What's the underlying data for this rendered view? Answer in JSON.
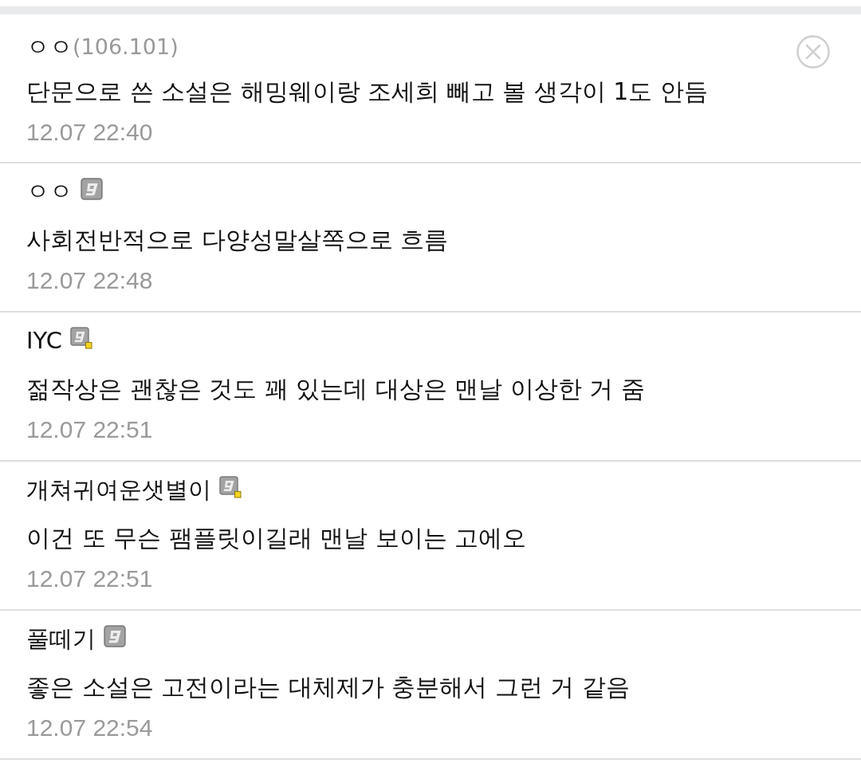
{
  "comments": [
    {
      "kind": "guest",
      "author": "ㅇㅇ",
      "ip": "(106.101)",
      "text": "단문으로 쓴 소설은 해밍웨이랑 조세희 빼고 볼 생각이 1도 안듬",
      "time": "12.07 22:40",
      "deletable": true
    },
    {
      "kind": "fixed",
      "author": "ㅇㅇ",
      "text": "사회전반적으로 다양성말살쪽으로 흐름",
      "time": "12.07 22:48",
      "deletable": false
    },
    {
      "kind": "semi",
      "author": "IYC",
      "text": "젊작상은 괜찮은 것도 꽤 있는데 대상은 맨날 이상한 거 줌",
      "time": "12.07 22:51",
      "deletable": false
    },
    {
      "kind": "semi",
      "author": "개쳐귀여운샛별이",
      "text": "이건 또 무슨 팸플릿이길래 맨날 보이는 고에오",
      "time": "12.07 22:51",
      "deletable": false
    },
    {
      "kind": "fixed",
      "author": "풀떼기",
      "text": "좋은 소설은 고전이라는 대체제가 충분해서 그런 거 같음",
      "time": "12.07 22:54",
      "deletable": false
    }
  ]
}
